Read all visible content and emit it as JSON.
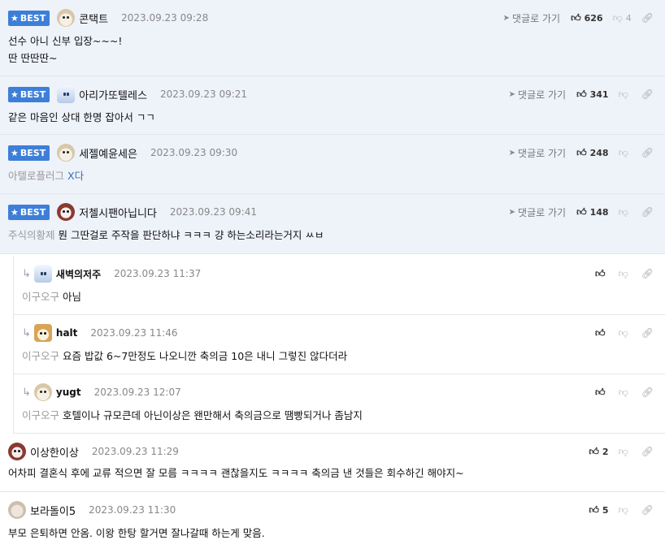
{
  "labels": {
    "best": "BEST",
    "goto_reply": "댓글로 가기"
  },
  "comments": [
    {
      "nick": "콘택트",
      "date": "2023.09.23 09:28",
      "lines": [
        "선수 아니 신부 입장~~~!",
        "딴 딴딴딴~"
      ],
      "likes": "626",
      "dislikes": "4"
    },
    {
      "nick": "아리가또텔레스",
      "date": "2023.09.23 09:21",
      "text": "같은 마음인 상대 한명 잡아서 ㄱㄱ",
      "likes": "341"
    },
    {
      "nick": "세젤예윤세은",
      "date": "2023.09.23 09:30",
      "quote": "아텔로플러그",
      "text": "X다",
      "likes": "248"
    },
    {
      "nick": "저첼시팬아닙니다",
      "date": "2023.09.23 09:41",
      "quote": "주식의황제",
      "text": "뭔 그딴걸로 주작을 판단하냐 ㅋㅋㅋ 걍 하는소리라는거지 ㅆㅂ",
      "likes": "148"
    },
    {
      "nick": "새벽의저주",
      "date": "2023.09.23 11:37",
      "quote": "이구오구",
      "text": "아님"
    },
    {
      "nick": "halt",
      "date": "2023.09.23 11:46",
      "quote": "이구오구",
      "text": "요즘 밥값 6~7만정도 나오니깐 축의금 10은 내니 그렇진 않다더라"
    },
    {
      "nick": "yugt",
      "date": "2023.09.23 12:07",
      "quote": "이구오구",
      "text": "호텔이나 규모큰데 아닌이상은 왠만해서 축의금으로 땜빵되거나 좀남지"
    },
    {
      "nick": "이상한이상",
      "date": "2023.09.23 11:29",
      "text": "어차피 결혼식 후에 교류 적으면 잘 모름 ㅋㅋㅋㅋ 괜찮을지도 ㅋㅋㅋㅋ 축의금 낸 것들은 회수하긴 해야지~",
      "likes": "2"
    },
    {
      "nick": "보라돌이5",
      "date": "2023.09.23 11:30",
      "text": "부모 은퇴하면 안옴. 이왕 한탕 할거면 잘나갈때 하는게 맞음.",
      "likes": "5"
    }
  ]
}
